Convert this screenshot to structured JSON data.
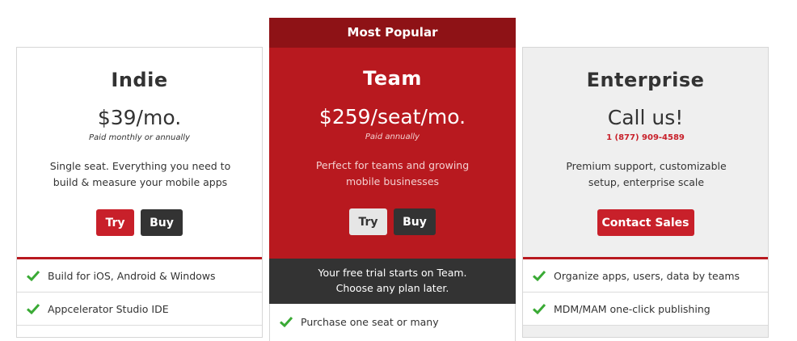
{
  "plans": {
    "indie": {
      "name": "Indie",
      "price": "$39/mo.",
      "price_note": "Paid monthly or annually",
      "description_line1": "Single seat. Everything you need to",
      "description_line2": "build & measure your mobile apps",
      "try_label": "Try",
      "buy_label": "Buy",
      "features": [
        "Build for iOS, Android & Windows",
        "Appcelerator Studio IDE"
      ]
    },
    "team": {
      "ribbon": "Most Popular",
      "name": "Team",
      "price": "$259/seat/mo.",
      "price_note": "Paid annually",
      "description_line1": "Perfect for teams and growing",
      "description_line2": "mobile businesses",
      "try_label": "Try",
      "buy_label": "Buy",
      "trial_line1": "Your free trial starts on Team.",
      "trial_line2": "Choose any plan later.",
      "features": [
        "Purchase one seat or many"
      ]
    },
    "enterprise": {
      "name": "Enterprise",
      "price": "Call us!",
      "phone": "1 (877) 909-4589",
      "description_line1": "Premium support, customizable",
      "description_line2": "setup, enterprise scale",
      "contact_label": "Contact Sales",
      "features": [
        "Organize apps, users, data by teams",
        "MDM/MAM one-click publishing"
      ]
    }
  },
  "colors": {
    "brand_red": "#b8191f",
    "ribbon_red": "#8e1216",
    "button_red": "#c8202a",
    "dark": "#333333",
    "check_green": "#3aaa35"
  },
  "icons": {
    "feature_check": "check-icon"
  }
}
